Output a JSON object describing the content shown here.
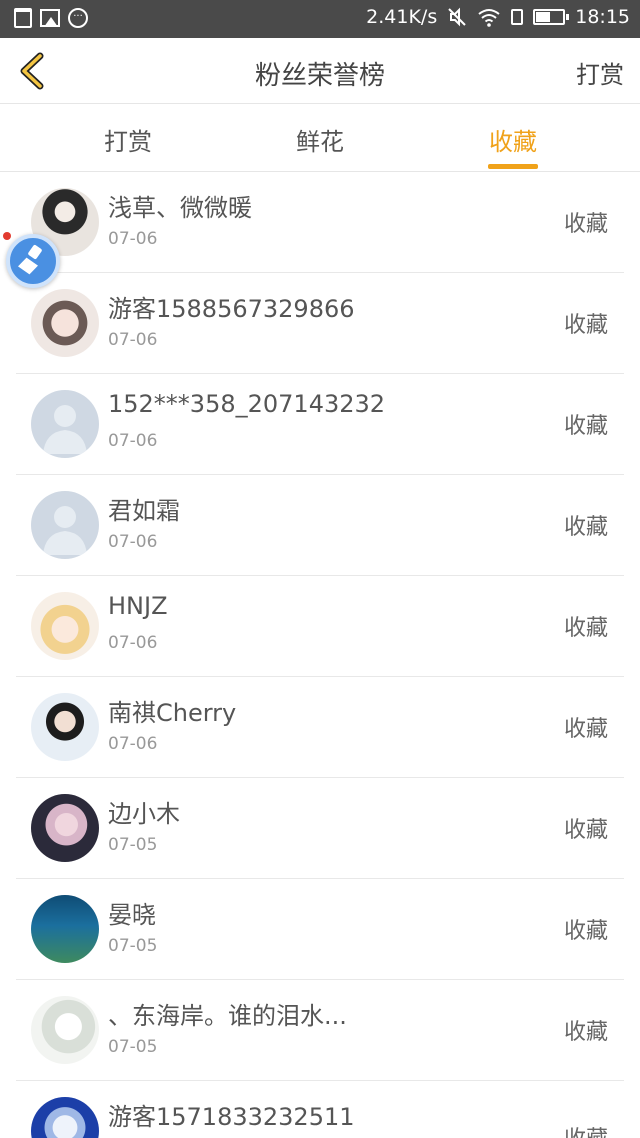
{
  "status_bar": {
    "speed": "2.41K/s",
    "time": "18:15"
  },
  "header": {
    "title": "粉丝荣誉榜",
    "right_action": "打赏"
  },
  "tabs": [
    {
      "label": "打赏",
      "active": false
    },
    {
      "label": "鲜花",
      "active": false
    },
    {
      "label": "收藏",
      "active": true
    }
  ],
  "accent_color": "#f0a21a",
  "items": [
    {
      "name": "浅草、微微暖",
      "date": "07-06",
      "action": "收藏"
    },
    {
      "name": "游客1588567329866",
      "date": "07-06",
      "action": "收藏"
    },
    {
      "name": "152***358_207143232",
      "date": "07-06",
      "action": "收藏"
    },
    {
      "name": "君如霜",
      "date": "07-06",
      "action": "收藏"
    },
    {
      "name": "HNJZ",
      "date": "07-06",
      "action": "收藏"
    },
    {
      "name": "南祺Cherry",
      "date": "07-06",
      "action": "收藏"
    },
    {
      "name": "边小木",
      "date": "07-05",
      "action": "收藏"
    },
    {
      "name": "晏晓",
      "date": "07-05",
      "action": "收藏"
    },
    {
      "name": "、东海岸。谁的泪水...",
      "date": "07-05",
      "action": "收藏"
    },
    {
      "name": "游客1571833232511",
      "date": "",
      "action": "收藏"
    }
  ]
}
